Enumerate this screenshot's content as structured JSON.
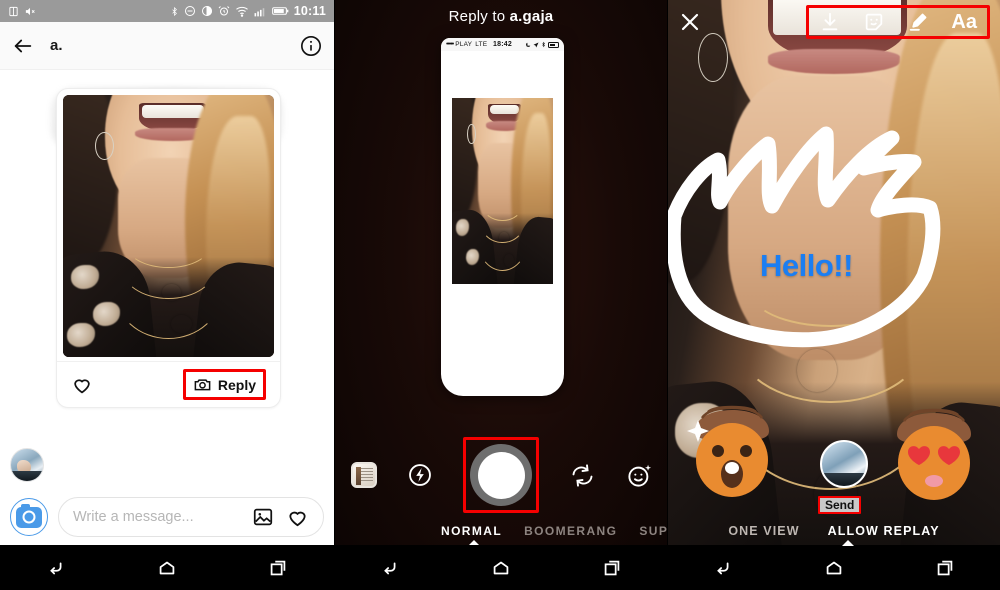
{
  "panel_left": {
    "status_bar": {
      "time": "10:11",
      "icons": [
        "sim-icon",
        "mute-icon",
        "bluetooth-icon",
        "do-not-disturb-icon",
        "display-icon",
        "alarm-icon",
        "wifi-icon",
        "signal-icon",
        "battery-icon"
      ]
    },
    "app_bar": {
      "back_icon": "back-arrow-icon",
      "title": "a.",
      "info_icon": "info-icon"
    },
    "thread": {
      "redacted_message": "",
      "card_like_icon": "heart-icon",
      "reply_button_label": "Reply",
      "reply_button_icon": "camera-icon",
      "highlight_color": "#f50000"
    },
    "composer": {
      "camera_button_icon": "camera-button-icon",
      "placeholder": "Write a message...",
      "gallery_icon": "gallery-icon",
      "heart_icon": "heart-icon",
      "accent_color": "#4a9ae8"
    },
    "nav_bar": {
      "back": "back-icon",
      "home": "home-icon",
      "recents": "recents-icon"
    }
  },
  "panel_middle": {
    "header_prefix": "Reply to ",
    "header_user": "a.gaja",
    "inner_phone_status": {
      "dots": "•••••",
      "carrier": "PLAY",
      "network": "LTE",
      "time": "18:42",
      "icons": [
        "moon-icon",
        "location-icon",
        "bluetooth-icon",
        "battery-icon"
      ]
    },
    "camera_controls": {
      "gallery_icon": "gallery-thumbnail-icon",
      "flash_icon": "flash-off-icon",
      "shutter_icon": "shutter-button-icon",
      "flip_icon": "flip-camera-icon",
      "effects_icon": "face-effects-icon",
      "highlight_color": "#f50000"
    },
    "modes": [
      {
        "label": "NORMAL",
        "active": true
      },
      {
        "label": "BOOMERANG",
        "active": false
      },
      {
        "label": "SUPE",
        "active": false
      }
    ],
    "nav_bar": {
      "back": "back-icon",
      "home": "home-icon",
      "recents": "recents-icon"
    }
  },
  "panel_right": {
    "close_icon": "close-icon",
    "tools": [
      {
        "name": "download-icon",
        "label": ""
      },
      {
        "name": "sticker-icon",
        "label": ""
      },
      {
        "name": "draw-pen-icon",
        "label": ""
      },
      {
        "name": "text-tool-icon",
        "label": "Aa"
      }
    ],
    "tools_highlight_color": "#f50000",
    "overlay_text": "Hello!!",
    "overlay_text_color": "#1b7ef2",
    "doodle_color": "#ffffff",
    "stickers": [
      {
        "name": "acorn-face-surprised-sticker",
        "emoji": "😮"
      },
      {
        "name": "acorn-face-hearts-sticker",
        "emoji": "😍"
      }
    ],
    "send_label": "Send",
    "send_highlight_color": "#f50000",
    "tabs": [
      {
        "label": "ONE VIEW",
        "active": false
      },
      {
        "label": "ALLOW REPLAY",
        "active": true
      }
    ],
    "nav_bar": {
      "back": "back-icon",
      "home": "home-icon",
      "recents": "recents-icon"
    }
  }
}
